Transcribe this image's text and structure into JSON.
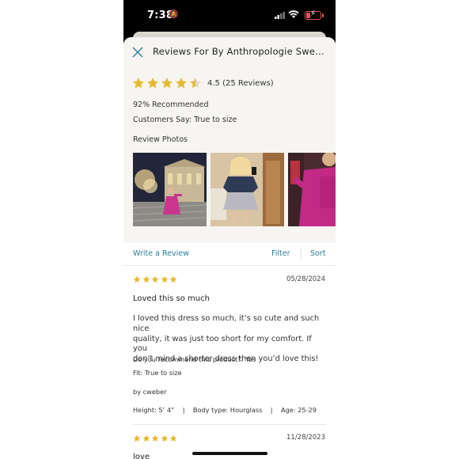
{
  "status_bar": {
    "time": "7:38"
  },
  "header": {
    "title": "Reviews For By Anthropologie Sweater..."
  },
  "summary": {
    "rating": 4.5,
    "rating_text": "4.5 (25 Reviews)",
    "recommended": "92% Recommended",
    "customers_say": "Customers Say: True to size",
    "photos_label": "Review Photos"
  },
  "actions": {
    "write_review": "Write a Review",
    "filter": "Filter",
    "sort": "Sort"
  },
  "reviews": [
    {
      "stars": 5,
      "date": "05/28/2024",
      "title": "Loved this so much",
      "body_lines": [
        "I loved this dress so much, it’s so cute and such nice",
        "quality, it was just too short for my comfort. If you",
        "don’t mind a shorter dress then you’d love this!"
      ],
      "recommend": "Do you recommend this product?: Yes",
      "fit": "Fit: True to size",
      "author": "by cweber",
      "attributes": "Height: 5’ 4”    |    Body type: Hourglass    |    Age: 25-29"
    },
    {
      "stars": 5,
      "date": "11/28/2023",
      "title": "love"
    }
  ],
  "colors": {
    "star": "#e8b830",
    "link": "#2d7d95",
    "header_bg": "#f6f5f1"
  }
}
